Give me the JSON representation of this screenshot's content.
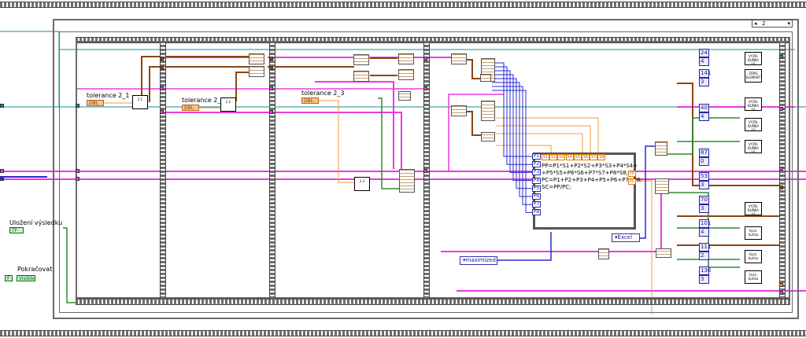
{
  "diagram": {
    "case_selector": "2",
    "controls": {
      "tolerance_1": {
        "label": "tolerance 2_1",
        "type": "DBL"
      },
      "tolerance_2": {
        "label": "tolerance 2_2",
        "type": "DBL"
      },
      "tolerance_3": {
        "label": "tolerance 2_3",
        "type": "DBL"
      },
      "save_result": {
        "label": "Uložení výsledku",
        "type": "TF"
      },
      "continue": {
        "label": "Pokračovat",
        "property": "Visible"
      }
    },
    "formula_node": {
      "inputs": [
        "P1",
        "P2",
        "P3",
        "P4",
        "P5",
        "P6",
        "P7",
        "P8"
      ],
      "outputs": [
        "S1",
        "S2",
        "S3",
        "S4",
        "S5",
        "S6",
        "S7",
        "S8"
      ],
      "right_outputs": [
        "PP",
        "PC"
      ],
      "lines": [
        "PP=P1*S1+P2*S2+P3*S3+P4*S4+",
        "+P5*S5+P6*S6+P7*S7+P8*S8;",
        "PC=P1+P2+P3+P4+P5+P6+P7+P8;",
        "SC=PP/PC;"
      ]
    },
    "enums": {
      "excel": "Excel",
      "maximized": "maximized"
    },
    "subvis": [
      "2.1",
      "2.2",
      "2.3"
    ],
    "constants": [
      {
        "values": [
          "24",
          "4"
        ]
      },
      {
        "values": [
          "141",
          "3"
        ]
      },
      {
        "values": [
          "40",
          "4"
        ]
      },
      {
        "values": [
          "87",
          "0"
        ]
      },
      {
        "values": [
          "53",
          "3"
        ]
      },
      {
        "values": [
          "70",
          "3"
        ]
      },
      {
        "values": [
          "101",
          "4"
        ]
      },
      {
        "values": [
          "111",
          "2"
        ]
      },
      {
        "values": [
          "136",
          "3"
        ]
      }
    ],
    "right_nodes": [
      "VYZN. BUŇKA 10",
      "ZÁPIS ELEMENT",
      "VYZN. BUŇKA 10",
      "VYZN. BUŇKA 10",
      "VYZN. BUŇKA 10",
      "VYZN. BUŇKA 10",
      "Vyzn. buňka",
      "Vyzn. buňka",
      "Vyzn. buňka"
    ]
  },
  "colors": {
    "pink": "#e83be0",
    "brown": "#8b4513",
    "green": "#2e8b2e",
    "blue": "#2a2ad0",
    "orange": "#f59a3b",
    "teal": "#1a8b8b",
    "gray": "#6a6a6a"
  }
}
